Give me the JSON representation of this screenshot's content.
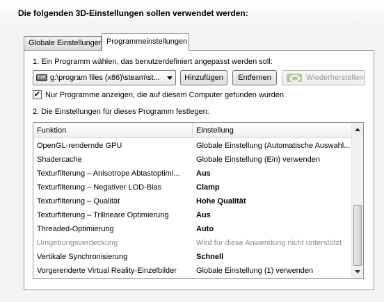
{
  "heading": "Die folgenden 3D-Einstellungen sollen verwendet werden:",
  "tabs": [
    {
      "label": "Globale Einstellungen"
    },
    {
      "label": "Programmeinstellungen"
    }
  ],
  "step1_label": "1. Ein Programm wählen, das benutzerdefiniert angepasst werden soll:",
  "program_select": {
    "value": "g:\\program files (x86)\\steam\\st...",
    "icon_text": "EXE"
  },
  "buttons": {
    "add": "Hinzufügen",
    "remove": "Entfernen",
    "restore": "Wiederherstellen"
  },
  "checkbox": {
    "label": "Nur Programme anzeigen, die auf diesem Computer gefunden wurden",
    "checked": true,
    "mark": "✔"
  },
  "step2_label": "2. Die Einstellungen für dieses Programm festlegen:",
  "table": {
    "columns": [
      "Funktion",
      "Einstellung"
    ],
    "rows": [
      {
        "function": "OpenGL-rendernde GPU",
        "setting": "Globale Einstellung (Automatische Auswahl...",
        "style": "normal"
      },
      {
        "function": "Shadercache",
        "setting": "Globale Einstellung (Ein) verwenden",
        "style": "normal"
      },
      {
        "function": "Texturfilterung – Anisotrope Abtastoptimi...",
        "setting": "Aus",
        "style": "bold"
      },
      {
        "function": "Texturfilterung – Negativer LOD-Bias",
        "setting": "Clamp",
        "style": "bold"
      },
      {
        "function": "Texturfilterung – Qualität",
        "setting": "Hohe Qualität",
        "style": "bold"
      },
      {
        "function": "Texturfilterung – Trilineare Optimierung",
        "setting": "Aus",
        "style": "bold"
      },
      {
        "function": "Threaded-Optimierung",
        "setting": "Auto",
        "style": "bold"
      },
      {
        "function": "Umgebungsverdeckung",
        "setting": "Wird für diese Anwendung nicht unterstützt",
        "style": "disabled"
      },
      {
        "function": "Vertikale Synchronisierung",
        "setting": "Schnell",
        "style": "bold"
      },
      {
        "function": "Vorgerenderte Virtual Reality-Einzelbilder",
        "setting": "Globale Einstellung (1) verwenden",
        "style": "normal"
      }
    ]
  }
}
